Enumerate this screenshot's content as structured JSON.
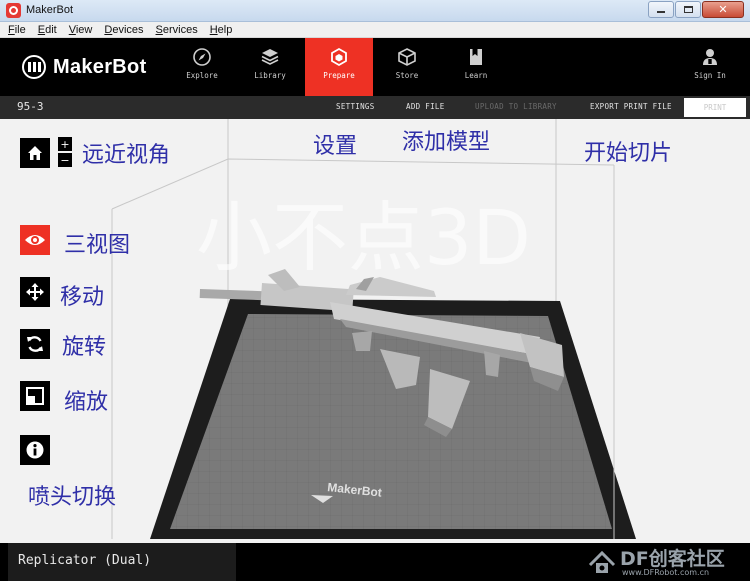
{
  "window": {
    "title": "MakerBot"
  },
  "menu": {
    "items": [
      {
        "label": "File",
        "u": "F",
        "rest": "ile"
      },
      {
        "label": "Edit",
        "u": "E",
        "rest": "dit"
      },
      {
        "label": "View",
        "u": "V",
        "rest": "iew"
      },
      {
        "label": "Devices",
        "u": "D",
        "rest": "evices"
      },
      {
        "label": "Services",
        "u": "S",
        "rest": "ervices"
      },
      {
        "label": "Help",
        "u": "H",
        "rest": "elp"
      }
    ]
  },
  "nav": {
    "brand": "MakerBot",
    "tabs": [
      {
        "label": "Explore",
        "icon": "compass-icon",
        "active": false
      },
      {
        "label": "Library",
        "icon": "library-icon",
        "active": false
      },
      {
        "label": "Prepare",
        "icon": "prepare-icon",
        "active": true
      },
      {
        "label": "Store",
        "icon": "store-icon",
        "active": false
      },
      {
        "label": "Learn",
        "icon": "learn-icon",
        "active": false
      }
    ],
    "sign_in": "Sign In"
  },
  "toolbar": {
    "file_name": "95-3",
    "settings": "SETTINGS",
    "add_file": "ADD FILE",
    "upload": "UPLOAD TO LIBRARY",
    "export": "EXPORT PRINT FILE",
    "print": "PRINT"
  },
  "viewport": {
    "watermark_text": "小不点3D",
    "plate_brand": "MakerBot"
  },
  "annotations": {
    "view_distance": "远近视角",
    "settings": "设置",
    "add_model": "添加模型",
    "start_slicing": "开始切片",
    "three_views": "三视图",
    "move": "移动",
    "rotate": "旋转",
    "scale": "缩放",
    "nozzle_switch": "喷头切换"
  },
  "zoom": {
    "plus": "+",
    "minus": "−"
  },
  "status": {
    "machine": "Replicator (Dual)"
  },
  "site_watermark": {
    "title": "DF创客社区",
    "url": "www.DFRobot.com.cn"
  },
  "colors": {
    "accent": "#ee3124",
    "annotation": "#2f2fa8",
    "nav_bg": "#000000"
  }
}
